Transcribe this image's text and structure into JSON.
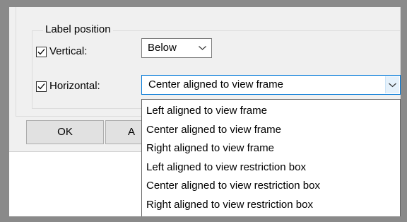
{
  "label_position": {
    "group_title": "Label position",
    "vertical": {
      "checked": true,
      "label": "Vertical:",
      "value": "Below"
    },
    "horizontal": {
      "checked": true,
      "label": "Horizontal:",
      "value": "Center aligned to view frame"
    }
  },
  "buttons": {
    "ok": "OK",
    "apply_partial": "A"
  },
  "dropdown": {
    "options": [
      "Left aligned to view frame",
      "Center aligned to view frame",
      "Right aligned to view frame",
      "Left aligned to view restriction box",
      "Center aligned to view restriction box",
      "Right aligned to view restriction box"
    ]
  },
  "icons": {
    "checkbox_check": "check-icon",
    "combo_arrow": "chevron-down-icon"
  },
  "colors": {
    "window_border": "#8a8a8a",
    "dialog_bg": "#f0f0f0",
    "focus_border": "#0078d7",
    "arrow_button_bg": "#e5f1fb"
  }
}
